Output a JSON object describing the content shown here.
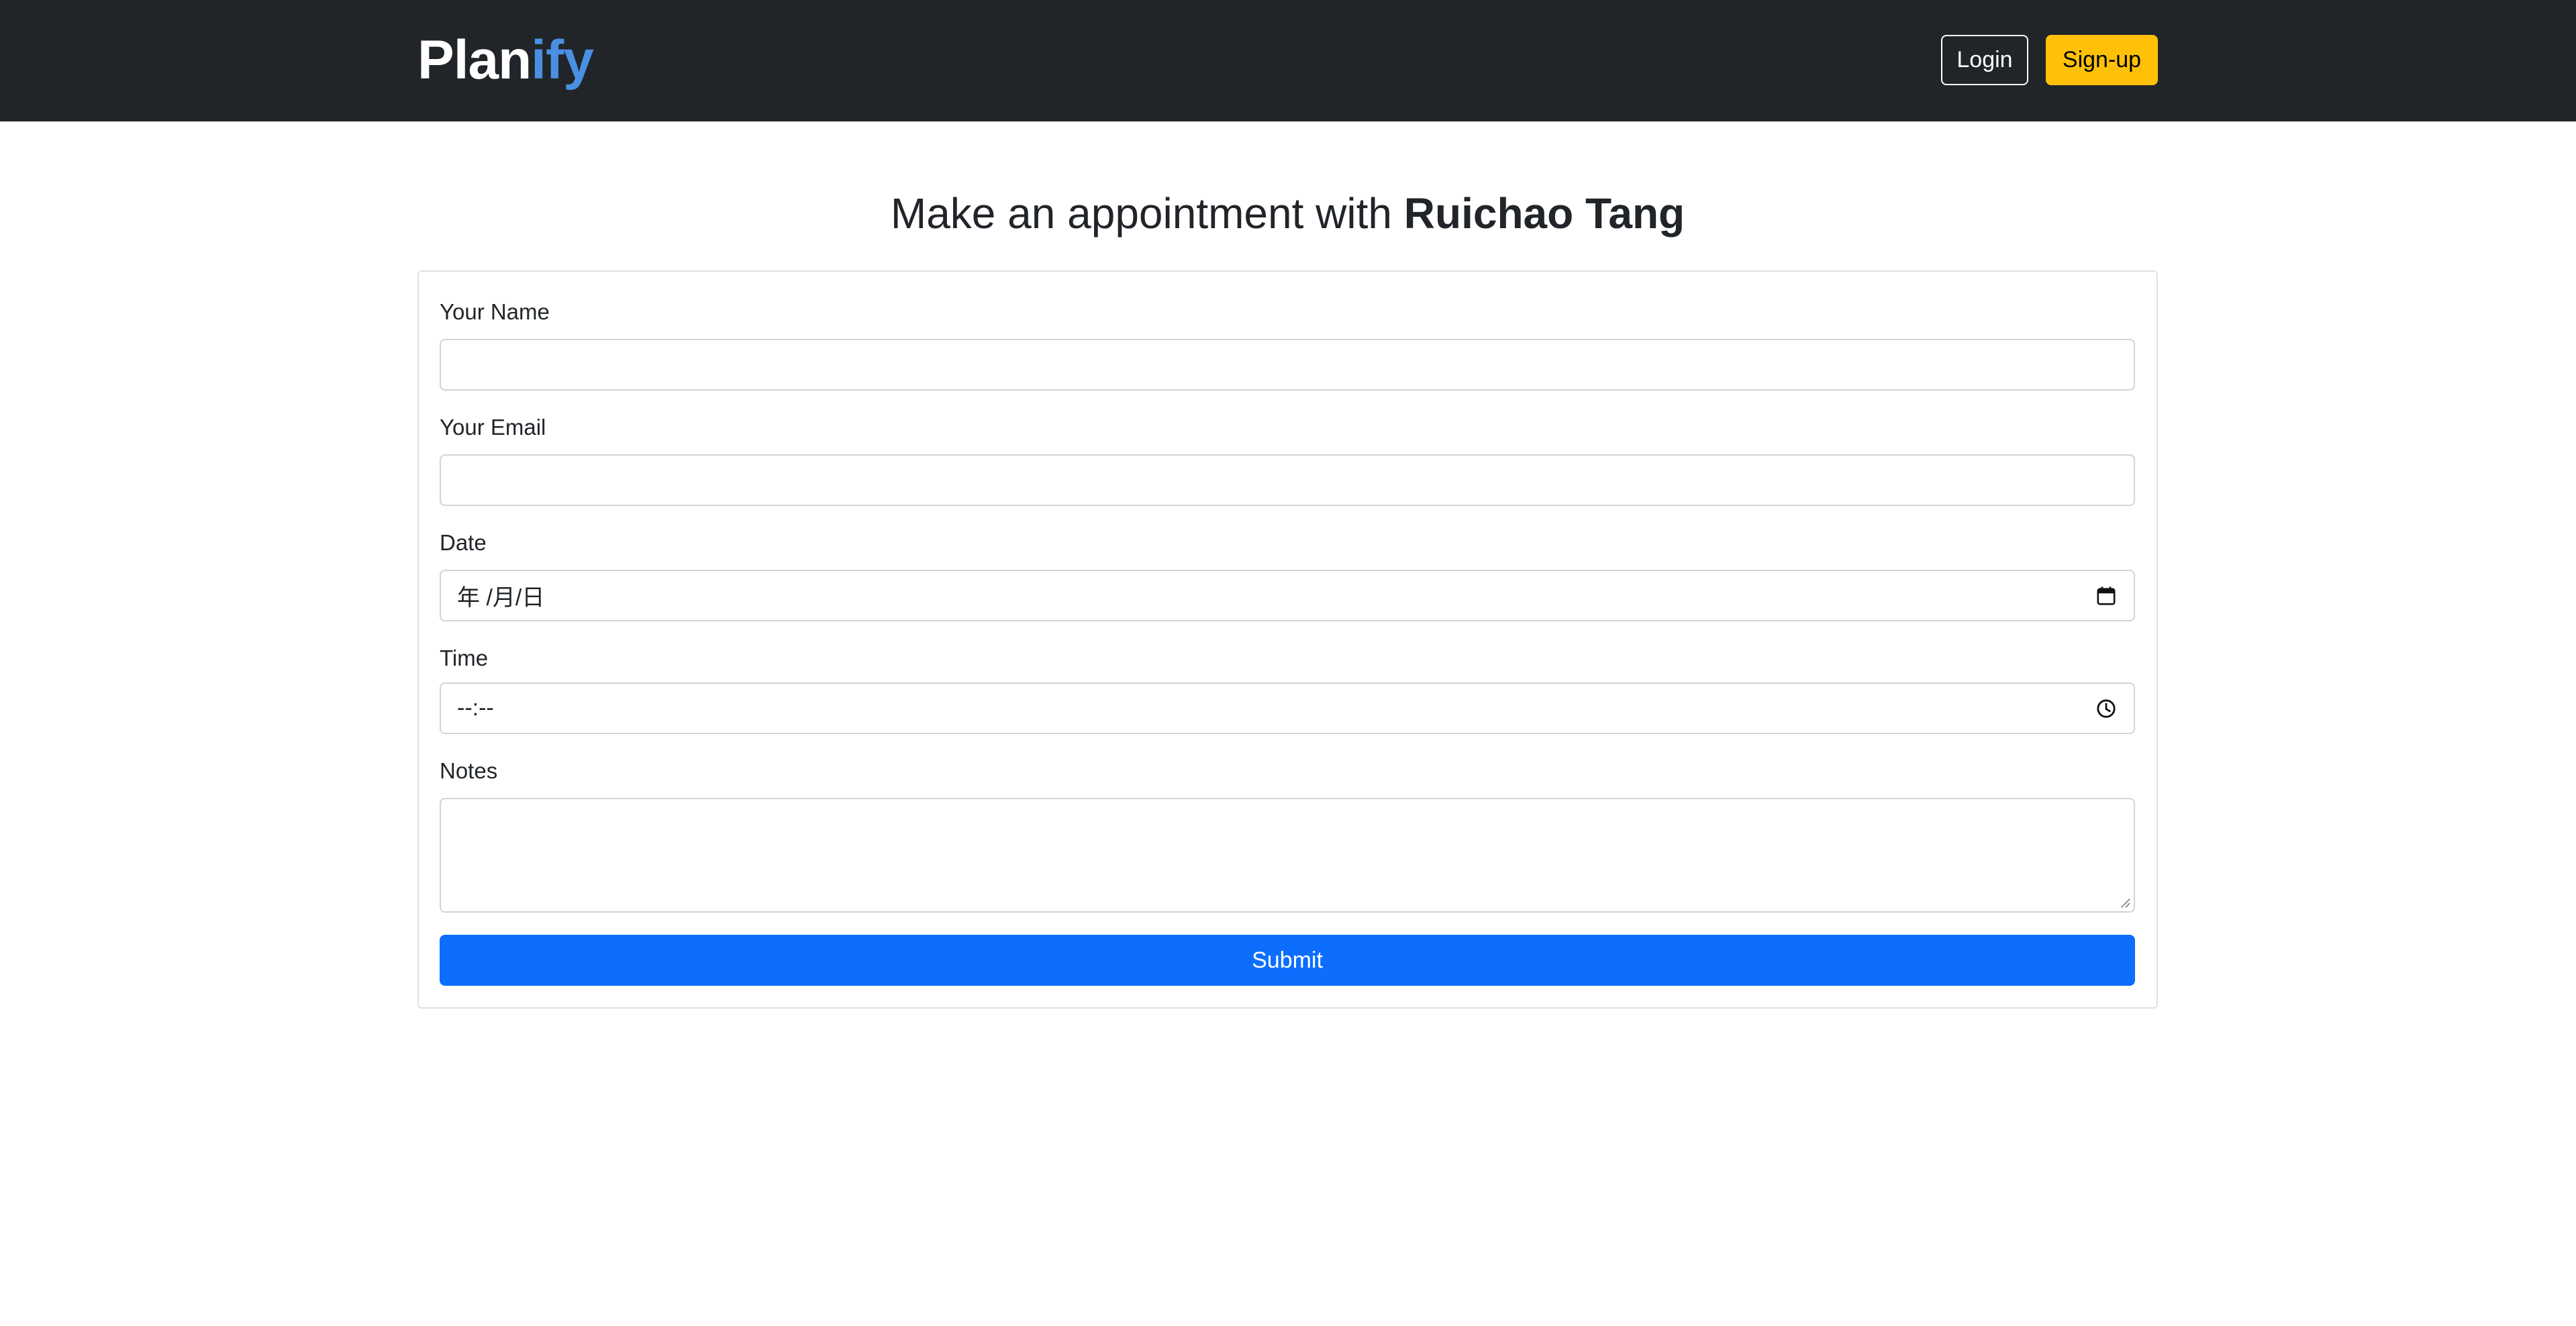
{
  "header": {
    "brand_part1": "Plan",
    "brand_part2": "ify",
    "login_label": "Login",
    "signup_label": "Sign-up",
    "colors": {
      "navbar_bg": "#212529",
      "brand_accent": "#4a90e2",
      "signup_bg": "#ffc107"
    }
  },
  "main": {
    "heading_prefix": "Make an appointment with ",
    "heading_name": "Ruichao Tang"
  },
  "form": {
    "name_label": "Your Name",
    "name_value": "",
    "email_label": "Your Email",
    "email_value": "",
    "date_label": "Date",
    "date_placeholder": "年 /月/日",
    "date_icon": "calendar-icon",
    "time_label": "Time",
    "time_placeholder": "--:--",
    "time_icon": "clock-icon",
    "notes_label": "Notes",
    "notes_value": "",
    "submit_label": "Submit",
    "colors": {
      "submit_bg": "#0d6efd"
    }
  }
}
